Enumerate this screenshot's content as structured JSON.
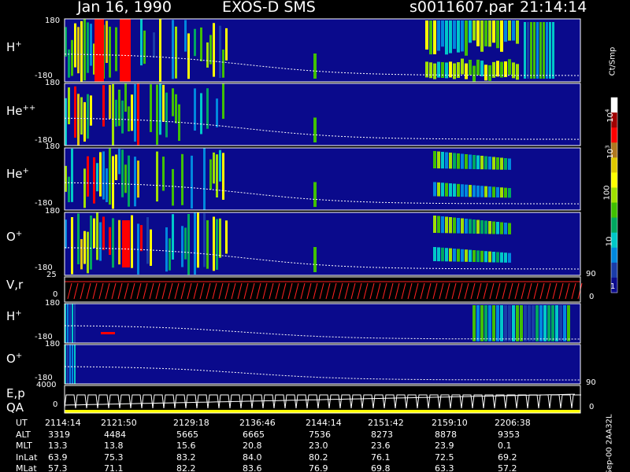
{
  "header": {
    "date": "Jan 16, 1990",
    "instrument": "EXOS-D SMS",
    "file": "s0011607.par",
    "time": "21:14:14"
  },
  "colorbar": {
    "unit": "Ct/Smp",
    "labels": [
      {
        "text": "1",
        "value": 1
      },
      {
        "text": "10",
        "value": 10
      },
      {
        "text": "100",
        "value": 100
      },
      {
        "text": "10",
        "value": 1000,
        "exp": "3"
      },
      {
        "text": "10",
        "value": 10000,
        "exp": "4"
      }
    ],
    "colors": [
      "#ffffff",
      "#a00000",
      "#ff0000",
      "#b07820",
      "#e0c800",
      "#ffff00",
      "#a0e000",
      "#40c000",
      "#00a860",
      "#00c8c8",
      "#0088dd",
      "#1a3ca8",
      "#0a0a8c"
    ]
  },
  "side_labels": {
    "deg90_a": "90",
    "deg90_b": "90",
    "zero_a": "0",
    "zero_b": "0"
  },
  "footer": {
    "stamp": "Sep-00 2AA32L",
    "row_labels": [
      "UT",
      "ALT",
      "MLT",
      "InLat",
      "MLat"
    ],
    "columns": [
      {
        "UT": "2114:14",
        "ALT": "3319",
        "MLT": "13.3",
        "InLat": "63.9",
        "MLat": "57.3"
      },
      {
        "UT": "2121:50",
        "ALT": "4484",
        "MLT": "13.8",
        "InLat": "75.3",
        "MLat": "71.1"
      },
      {
        "UT": "2129:18",
        "ALT": "5665",
        "MLT": "15.6",
        "InLat": "83.2",
        "MLat": "82.2"
      },
      {
        "UT": "2136:46",
        "ALT": "6665",
        "MLT": "20.8",
        "InLat": "84.0",
        "MLat": "83.6"
      },
      {
        "UT": "2144:14",
        "ALT": "7536",
        "MLT": "23.0",
        "InLat": "80.2",
        "MLat": "76.9"
      },
      {
        "UT": "2151:42",
        "ALT": "8273",
        "MLT": "23.6",
        "InLat": "76.1",
        "MLat": "69.8"
      },
      {
        "UT": "2159:10",
        "ALT": "8878",
        "MLT": "23.9",
        "InLat": "72.5",
        "MLat": "63.3"
      },
      {
        "UT": "2206:38",
        "ALT": "9353",
        "MLT": "0.1",
        "InLat": "69.2",
        "MLat": "57.2"
      }
    ]
  },
  "chart_data": [
    {
      "type": "heatmap",
      "panel": "H+ pitch angle",
      "label": "H",
      "charge": "+",
      "ylim": [
        -180,
        180
      ],
      "tick_labels": [
        "180",
        "-180"
      ]
    },
    {
      "type": "heatmap",
      "panel": "He++ pitch angle",
      "label": "He",
      "charge": "++",
      "ylim": [
        -180,
        180
      ],
      "tick_labels": [
        "180",
        "-180"
      ]
    },
    {
      "type": "heatmap",
      "panel": "He+ pitch angle",
      "label": "He",
      "charge": "+",
      "ylim": [
        -180,
        180
      ],
      "tick_labels": [
        "180",
        "-180"
      ]
    },
    {
      "type": "heatmap",
      "panel": "O+ pitch angle",
      "label": "O",
      "charge": "+",
      "ylim": [
        -180,
        180
      ],
      "tick_labels": [
        "180",
        "-180"
      ]
    },
    {
      "type": "line",
      "panel": "V,r",
      "label": "V,r",
      "ylim": [
        0,
        25
      ],
      "tick_labels": [
        "25",
        "0"
      ]
    },
    {
      "type": "heatmap",
      "panel": "H+ second",
      "label": "H",
      "charge": "+",
      "ylim": [
        -180,
        180
      ],
      "tick_labels": [
        "180",
        "-180"
      ]
    },
    {
      "type": "heatmap",
      "panel": "O+ second",
      "label": "O",
      "charge": "+",
      "ylim": [
        -180,
        180
      ],
      "tick_labels": [
        "180",
        "-180"
      ]
    },
    {
      "type": "line",
      "panel": "E,p QA",
      "label": "E,p",
      "label2": "QA",
      "ylim": [
        0,
        4000
      ],
      "tick_labels": [
        "4000",
        "0"
      ]
    }
  ]
}
